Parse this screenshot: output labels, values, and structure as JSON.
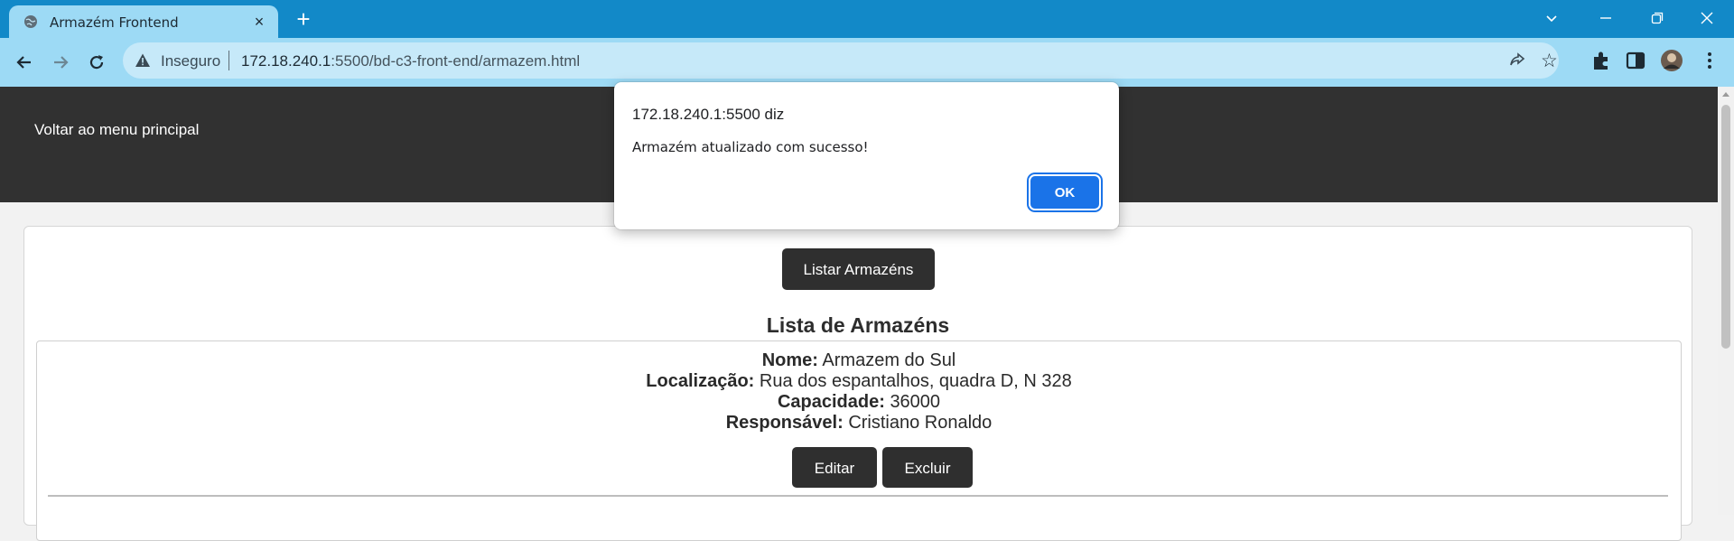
{
  "browser": {
    "tab_title": "Armazém Frontend",
    "security_label": "Inseguro",
    "url_host": "172.18.240.1",
    "url_rest": ":5500/bd-c3-front-end/armazem.html"
  },
  "page": {
    "back_link": "Voltar ao menu principal",
    "list_button": "Listar Armazéns",
    "list_title": "Lista de Armazéns",
    "warehouse": {
      "name_label": "Nome:",
      "name": "Armazem do Sul",
      "location_label": "Localização:",
      "location": "Rua dos espantalhos, quadra D, N 328",
      "capacity_label": "Capacidade:",
      "capacity": "36000",
      "manager_label": "Responsável:",
      "manager": "Cristiano Ronaldo",
      "edit_button": "Editar",
      "delete_button": "Excluir"
    }
  },
  "dialog": {
    "origin": "172.18.240.1:5500 diz",
    "message": "Armazém atualizado com sucesso!",
    "ok_button": "OK"
  },
  "colors": {
    "tabbar": "#1289c8",
    "toolbar": "#9ddaf5",
    "header": "#313131",
    "button_dark": "#2f2f2f",
    "dialog_ok": "#1a73e8"
  }
}
